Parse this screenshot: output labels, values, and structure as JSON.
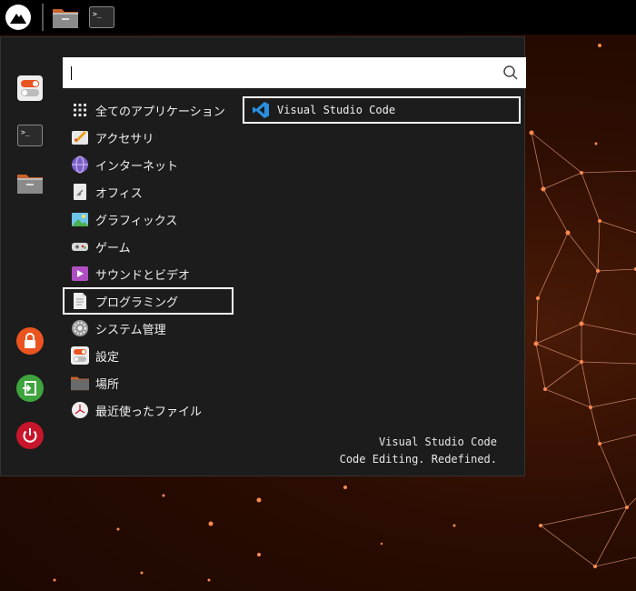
{
  "panel": {
    "menu_icon": "app-menu-logo-icon",
    "launchers": [
      {
        "name": "files",
        "icon": "folder-icon"
      },
      {
        "name": "terminal",
        "icon": "terminal-icon"
      }
    ]
  },
  "favorites": [
    {
      "name": "settings",
      "icon": "toggle-settings-icon"
    },
    {
      "name": "terminal",
      "icon": "terminal-icon"
    },
    {
      "name": "files",
      "icon": "folder-icon"
    },
    {
      "name": "lock",
      "icon": "lock-icon",
      "color": "#e95420"
    },
    {
      "name": "logout",
      "icon": "logout-icon",
      "color": "#3ea43e"
    },
    {
      "name": "power",
      "icon": "power-icon",
      "color": "#c7162b"
    }
  ],
  "search": {
    "value": "",
    "placeholder": ""
  },
  "categories": [
    {
      "label": "全てのアプリケーション",
      "icon": "grid-icon"
    },
    {
      "label": "アクセサリ",
      "icon": "accessories-icon"
    },
    {
      "label": "インターネット",
      "icon": "globe-icon"
    },
    {
      "label": "オフィス",
      "icon": "office-icon"
    },
    {
      "label": "グラフィックス",
      "icon": "image-icon"
    },
    {
      "label": "ゲーム",
      "icon": "gamepad-icon"
    },
    {
      "label": "サウンドとビデオ",
      "icon": "play-icon"
    },
    {
      "label": "プログラミング",
      "icon": "document-code-icon",
      "selected": true
    },
    {
      "label": "システム管理",
      "icon": "gear-icon"
    },
    {
      "label": "設定",
      "icon": "toggle-settings-icon"
    },
    {
      "label": "場所",
      "icon": "folder-icon"
    },
    {
      "label": "最近使ったファイル",
      "icon": "clock-icon"
    }
  ],
  "apps": [
    {
      "label": "Visual Studio Code",
      "icon": "vscode-icon",
      "selected": true
    }
  ],
  "description": {
    "title": "Visual Studio Code",
    "subtitle": "Code Editing. Redefined."
  },
  "colors": {
    "accent_orange": "#e95420",
    "vscode_blue": "#2a8fe0",
    "menu_bg": "#1c1c1c"
  }
}
